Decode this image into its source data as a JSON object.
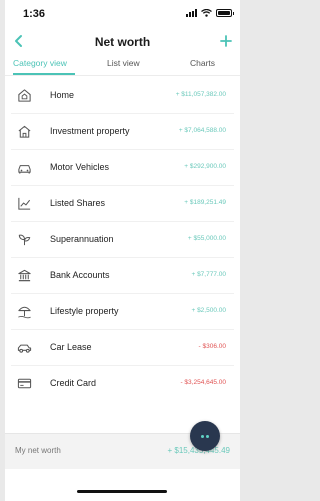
{
  "status_bar": {
    "time": "1:36"
  },
  "header": {
    "title": "Net worth"
  },
  "tabs": [
    {
      "label": "Category view",
      "active": true
    },
    {
      "label": "List view",
      "active": false
    },
    {
      "label": "Charts",
      "active": false
    }
  ],
  "categories": [
    {
      "icon": "home-icon",
      "label": "Home",
      "value": "+ $11,057,382.00",
      "sign": "pos"
    },
    {
      "icon": "investment-property-icon",
      "label": "Investment property",
      "value": "+ $7,064,588.00",
      "sign": "pos"
    },
    {
      "icon": "car-icon",
      "label": "Motor Vehicles",
      "value": "+ $292,900.00",
      "sign": "pos"
    },
    {
      "icon": "shares-chart-icon",
      "label": "Listed Shares",
      "value": "+ $189,251.49",
      "sign": "pos"
    },
    {
      "icon": "seedling-icon",
      "label": "Superannuation",
      "value": "+ $55,000.00",
      "sign": "pos"
    },
    {
      "icon": "bank-icon",
      "label": "Bank Accounts",
      "value": "+ $7,777.00",
      "sign": "pos"
    },
    {
      "icon": "beach-umbrella-icon",
      "label": "Lifestyle property",
      "value": "+ $2,500.00",
      "sign": "pos"
    },
    {
      "icon": "car-lease-icon",
      "label": "Car Lease",
      "value": "- $306.00",
      "sign": "neg"
    },
    {
      "icon": "credit-card-icon",
      "label": "Credit Card",
      "value": "- $3,254,645.00",
      "sign": "neg"
    }
  ],
  "footer": {
    "label": "My net worth",
    "value": "+ $15,435,445.49"
  },
  "colors": {
    "accent": "#4bc3b6",
    "positive": "#6bc9bb",
    "negative": "#e05353",
    "fab": "#29374f"
  }
}
